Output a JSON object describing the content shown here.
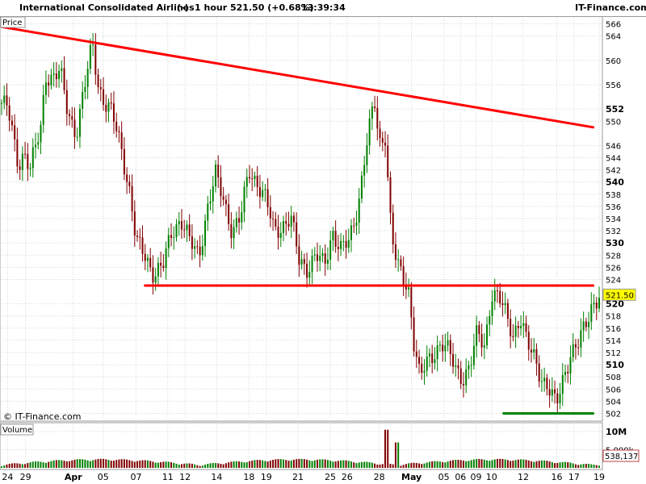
{
  "header": {
    "instrument": "International Consolidated Airlines",
    "suffix": "(-)",
    "interval": "1 hour",
    "price_change": "521.50 (+0.68%)",
    "time": "13:39:34",
    "brand": "IT-Finance.com"
  },
  "panels": {
    "price_label": "Price",
    "volume_label": "Volume",
    "watermark": "© IT-Finance.com"
  },
  "colors": {
    "up": "#008000",
    "down": "#800000",
    "trend": "#ff0000",
    "support": "#008000",
    "grid": "#d6d6d6",
    "last_price_bg": "#ffff00"
  },
  "chart_data": {
    "type": "candlestick",
    "y_range": [
      501,
      567
    ],
    "volume_range": [
      0,
      12000000
    ],
    "price_ticks": [
      {
        "label": "502",
        "value": 502,
        "bold": false
      },
      {
        "label": "504",
        "value": 504,
        "bold": false
      },
      {
        "label": "506",
        "value": 506,
        "bold": false
      },
      {
        "label": "508",
        "value": 508,
        "bold": false
      },
      {
        "label": "510",
        "value": 510,
        "bold": true
      },
      {
        "label": "512",
        "value": 512,
        "bold": false
      },
      {
        "label": "514",
        "value": 514,
        "bold": false
      },
      {
        "label": "516",
        "value": 516,
        "bold": false
      },
      {
        "label": "518",
        "value": 518,
        "bold": false
      },
      {
        "label": "520",
        "value": 520,
        "bold": true
      },
      {
        "label": "524",
        "value": 524,
        "bold": false
      },
      {
        "label": "526",
        "value": 526,
        "bold": false
      },
      {
        "label": "528",
        "value": 528,
        "bold": false
      },
      {
        "label": "530",
        "value": 530,
        "bold": true
      },
      {
        "label": "532",
        "value": 532,
        "bold": false
      },
      {
        "label": "534",
        "value": 534,
        "bold": false
      },
      {
        "label": "536",
        "value": 536,
        "bold": false
      },
      {
        "label": "538",
        "value": 538,
        "bold": false
      },
      {
        "label": "540",
        "value": 540,
        "bold": true
      },
      {
        "label": "542",
        "value": 542,
        "bold": false
      },
      {
        "label": "544",
        "value": 544,
        "bold": false
      },
      {
        "label": "546",
        "value": 546,
        "bold": false
      },
      {
        "label": "550",
        "value": 550,
        "bold": false
      },
      {
        "label": "552",
        "value": 552,
        "bold": true
      },
      {
        "label": "556",
        "value": 556,
        "bold": false
      },
      {
        "label": "560",
        "value": 560,
        "bold": false
      },
      {
        "label": "564",
        "value": 564,
        "bold": false
      },
      {
        "label": "566",
        "value": 566,
        "bold": false
      }
    ],
    "last_price": {
      "label": "521.50",
      "value": 521.5
    },
    "volume_ticks": [
      {
        "label": "10M",
        "value": 10000000,
        "bold": true
      },
      {
        "label": "5,000k",
        "value": 5000000,
        "bold": false
      }
    ],
    "last_volume": {
      "label": "538,137",
      "value": 538137
    },
    "date_ticks": [
      {
        "label": "24",
        "pos": 0.01,
        "bold": false
      },
      {
        "label": "29",
        "pos": 0.04,
        "bold": false
      },
      {
        "label": "Apr",
        "pos": 0.12,
        "bold": true
      },
      {
        "label": "05",
        "pos": 0.17,
        "bold": false
      },
      {
        "label": "07",
        "pos": 0.225,
        "bold": false
      },
      {
        "label": "11",
        "pos": 0.278,
        "bold": false
      },
      {
        "label": "12",
        "pos": 0.307,
        "bold": false
      },
      {
        "label": "14",
        "pos": 0.36,
        "bold": false
      },
      {
        "label": "18",
        "pos": 0.414,
        "bold": false
      },
      {
        "label": "19",
        "pos": 0.443,
        "bold": false
      },
      {
        "label": "21",
        "pos": 0.496,
        "bold": false
      },
      {
        "label": "25",
        "pos": 0.55,
        "bold": false
      },
      {
        "label": "26",
        "pos": 0.578,
        "bold": false
      },
      {
        "label": "28",
        "pos": 0.632,
        "bold": false
      },
      {
        "label": "May",
        "pos": 0.686,
        "bold": true
      },
      {
        "label": "05",
        "pos": 0.74,
        "bold": false
      },
      {
        "label": "06",
        "pos": 0.768,
        "bold": false
      },
      {
        "label": "09",
        "pos": 0.794,
        "bold": false
      },
      {
        "label": "10",
        "pos": 0.82,
        "bold": false
      },
      {
        "label": "12",
        "pos": 0.873,
        "bold": false
      },
      {
        "label": "16",
        "pos": 0.929,
        "bold": false
      },
      {
        "label": "17",
        "pos": 0.958,
        "bold": false
      },
      {
        "label": "19",
        "pos": 1.0,
        "bold": false
      }
    ],
    "series": [
      {
        "t": 0.0,
        "v": 553
      },
      {
        "t": 0.01,
        "v": 552
      },
      {
        "t": 0.018,
        "v": 548
      },
      {
        "t": 0.028,
        "v": 543
      },
      {
        "t": 0.038,
        "v": 545
      },
      {
        "t": 0.048,
        "v": 542
      },
      {
        "t": 0.058,
        "v": 546
      },
      {
        "t": 0.068,
        "v": 550
      },
      {
        "t": 0.072,
        "v": 558
      },
      {
        "t": 0.085,
        "v": 557
      },
      {
        "t": 0.098,
        "v": 558
      },
      {
        "t": 0.11,
        "v": 552
      },
      {
        "t": 0.125,
        "v": 548
      },
      {
        "t": 0.14,
        "v": 556
      },
      {
        "t": 0.152,
        "v": 563
      },
      {
        "t": 0.162,
        "v": 556
      },
      {
        "t": 0.172,
        "v": 553
      },
      {
        "t": 0.185,
        "v": 551
      },
      {
        "t": 0.2,
        "v": 546
      },
      {
        "t": 0.215,
        "v": 538
      },
      {
        "t": 0.225,
        "v": 530
      },
      {
        "t": 0.24,
        "v": 528
      },
      {
        "t": 0.255,
        "v": 525
      },
      {
        "t": 0.27,
        "v": 526
      },
      {
        "t": 0.285,
        "v": 532
      },
      {
        "t": 0.3,
        "v": 534
      },
      {
        "t": 0.315,
        "v": 530
      },
      {
        "t": 0.33,
        "v": 528
      },
      {
        "t": 0.345,
        "v": 536
      },
      {
        "t": 0.358,
        "v": 541
      },
      {
        "t": 0.372,
        "v": 537
      },
      {
        "t": 0.386,
        "v": 532
      },
      {
        "t": 0.4,
        "v": 534
      },
      {
        "t": 0.414,
        "v": 542
      },
      {
        "t": 0.428,
        "v": 540
      },
      {
        "t": 0.442,
        "v": 537
      },
      {
        "t": 0.456,
        "v": 532
      },
      {
        "t": 0.47,
        "v": 533
      },
      {
        "t": 0.484,
        "v": 534
      },
      {
        "t": 0.498,
        "v": 527
      },
      {
        "t": 0.512,
        "v": 526
      },
      {
        "t": 0.526,
        "v": 528
      },
      {
        "t": 0.54,
        "v": 526
      },
      {
        "t": 0.554,
        "v": 532
      },
      {
        "t": 0.568,
        "v": 529
      },
      {
        "t": 0.582,
        "v": 530
      },
      {
        "t": 0.596,
        "v": 536
      },
      {
        "t": 0.61,
        "v": 546
      },
      {
        "t": 0.624,
        "v": 553
      },
      {
        "t": 0.632,
        "v": 546
      },
      {
        "t": 0.642,
        "v": 548
      },
      {
        "t": 0.652,
        "v": 532
      },
      {
        "t": 0.662,
        "v": 526
      },
      {
        "t": 0.672,
        "v": 524
      },
      {
        "t": 0.682,
        "v": 522
      },
      {
        "t": 0.69,
        "v": 514
      },
      {
        "t": 0.7,
        "v": 508
      },
      {
        "t": 0.712,
        "v": 510
      },
      {
        "t": 0.724,
        "v": 512
      },
      {
        "t": 0.736,
        "v": 514
      },
      {
        "t": 0.748,
        "v": 512
      },
      {
        "t": 0.76,
        "v": 509
      },
      {
        "t": 0.772,
        "v": 508
      },
      {
        "t": 0.784,
        "v": 510
      },
      {
        "t": 0.796,
        "v": 515
      },
      {
        "t": 0.808,
        "v": 513
      },
      {
        "t": 0.82,
        "v": 522
      },
      {
        "t": 0.832,
        "v": 521
      },
      {
        "t": 0.844,
        "v": 518
      },
      {
        "t": 0.856,
        "v": 515
      },
      {
        "t": 0.868,
        "v": 518
      },
      {
        "t": 0.88,
        "v": 513
      },
      {
        "t": 0.892,
        "v": 511
      },
      {
        "t": 0.904,
        "v": 508
      },
      {
        "t": 0.916,
        "v": 506
      },
      {
        "t": 0.928,
        "v": 503
      },
      {
        "t": 0.94,
        "v": 508
      },
      {
        "t": 0.952,
        "v": 512
      },
      {
        "t": 0.964,
        "v": 513
      },
      {
        "t": 0.976,
        "v": 516
      },
      {
        "t": 0.988,
        "v": 520
      },
      {
        "t": 1.0,
        "v": 521.5
      }
    ],
    "trendlines": [
      {
        "name": "resistance-down",
        "color": "#ff0000",
        "from": {
          "t": 0.0,
          "v": 565.5
        },
        "to": {
          "t": 0.99,
          "v": 549
        }
      },
      {
        "name": "support-upper",
        "color": "#ff0000",
        "from": {
          "t": 0.24,
          "v": 523
        },
        "to": {
          "t": 0.99,
          "v": 523
        }
      },
      {
        "name": "support-lower",
        "color": "#008000",
        "from": {
          "t": 0.84,
          "v": 502
        },
        "to": {
          "t": 0.99,
          "v": 502
        }
      }
    ]
  }
}
